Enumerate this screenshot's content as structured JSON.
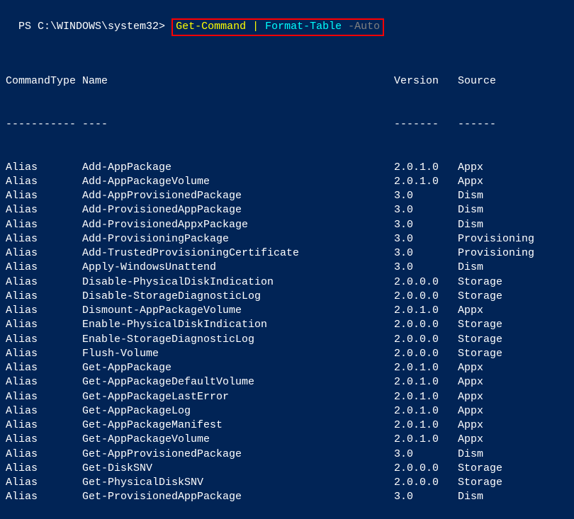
{
  "prompt": {
    "prefix": "PS C:\\WINDOWS\\system32> ",
    "cmd1": "Get-Command ",
    "pipe": "| ",
    "cmd2": "Format-Table ",
    "param": "-Auto"
  },
  "headers": {
    "type": "CommandType",
    "name": "Name",
    "version": "Version",
    "source": "Source"
  },
  "rules": {
    "type": "-----------",
    "name": "----",
    "version": "-------",
    "source": "------"
  },
  "rows": [
    {
      "type": "Alias",
      "name": "Add-AppPackage",
      "version": "2.0.1.0",
      "source": "Appx"
    },
    {
      "type": "Alias",
      "name": "Add-AppPackageVolume",
      "version": "2.0.1.0",
      "source": "Appx"
    },
    {
      "type": "Alias",
      "name": "Add-AppProvisionedPackage",
      "version": "3.0",
      "source": "Dism"
    },
    {
      "type": "Alias",
      "name": "Add-ProvisionedAppPackage",
      "version": "3.0",
      "source": "Dism"
    },
    {
      "type": "Alias",
      "name": "Add-ProvisionedAppxPackage",
      "version": "3.0",
      "source": "Dism"
    },
    {
      "type": "Alias",
      "name": "Add-ProvisioningPackage",
      "version": "3.0",
      "source": "Provisioning"
    },
    {
      "type": "Alias",
      "name": "Add-TrustedProvisioningCertificate",
      "version": "3.0",
      "source": "Provisioning"
    },
    {
      "type": "Alias",
      "name": "Apply-WindowsUnattend",
      "version": "3.0",
      "source": "Dism"
    },
    {
      "type": "Alias",
      "name": "Disable-PhysicalDiskIndication",
      "version": "2.0.0.0",
      "source": "Storage"
    },
    {
      "type": "Alias",
      "name": "Disable-StorageDiagnosticLog",
      "version": "2.0.0.0",
      "source": "Storage"
    },
    {
      "type": "Alias",
      "name": "Dismount-AppPackageVolume",
      "version": "2.0.1.0",
      "source": "Appx"
    },
    {
      "type": "Alias",
      "name": "Enable-PhysicalDiskIndication",
      "version": "2.0.0.0",
      "source": "Storage"
    },
    {
      "type": "Alias",
      "name": "Enable-StorageDiagnosticLog",
      "version": "2.0.0.0",
      "source": "Storage"
    },
    {
      "type": "Alias",
      "name": "Flush-Volume",
      "version": "2.0.0.0",
      "source": "Storage"
    },
    {
      "type": "Alias",
      "name": "Get-AppPackage",
      "version": "2.0.1.0",
      "source": "Appx"
    },
    {
      "type": "Alias",
      "name": "Get-AppPackageDefaultVolume",
      "version": "2.0.1.0",
      "source": "Appx"
    },
    {
      "type": "Alias",
      "name": "Get-AppPackageLastError",
      "version": "2.0.1.0",
      "source": "Appx"
    },
    {
      "type": "Alias",
      "name": "Get-AppPackageLog",
      "version": "2.0.1.0",
      "source": "Appx"
    },
    {
      "type": "Alias",
      "name": "Get-AppPackageManifest",
      "version": "2.0.1.0",
      "source": "Appx"
    },
    {
      "type": "Alias",
      "name": "Get-AppPackageVolume",
      "version": "2.0.1.0",
      "source": "Appx"
    },
    {
      "type": "Alias",
      "name": "Get-AppProvisionedPackage",
      "version": "3.0",
      "source": "Dism"
    },
    {
      "type": "Alias",
      "name": "Get-DiskSNV",
      "version": "2.0.0.0",
      "source": "Storage"
    },
    {
      "type": "Alias",
      "name": "Get-PhysicalDiskSNV",
      "version": "2.0.0.0",
      "source": "Storage"
    },
    {
      "type": "Alias",
      "name": "Get-ProvisionedAppPackage",
      "version": "3.0",
      "source": "Dism"
    }
  ]
}
